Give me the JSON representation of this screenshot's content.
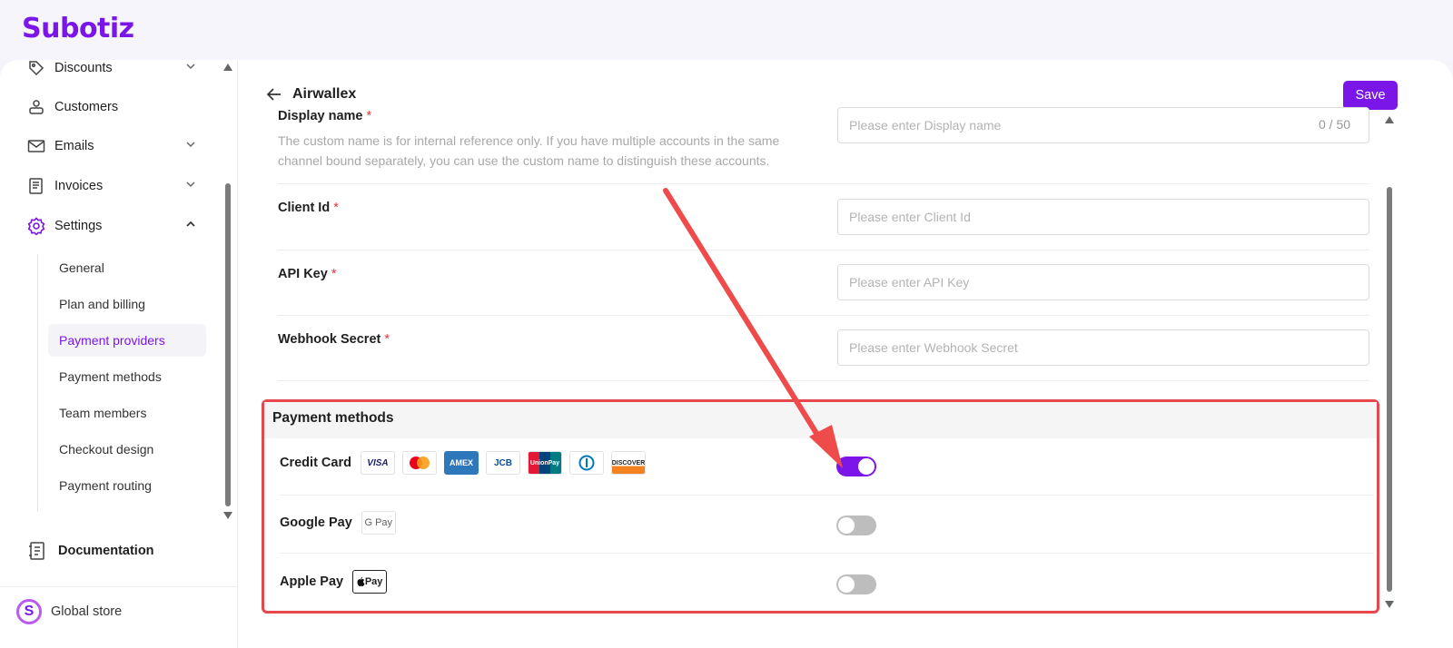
{
  "brand": {
    "name": "Subotiz"
  },
  "sidebar": {
    "items": [
      {
        "label": "Discounts"
      },
      {
        "label": "Customers"
      },
      {
        "label": "Emails"
      },
      {
        "label": "Invoices"
      },
      {
        "label": "Settings"
      }
    ],
    "settings_sub": [
      {
        "label": "General"
      },
      {
        "label": "Plan and billing"
      },
      {
        "label": "Payment providers"
      },
      {
        "label": "Payment methods"
      },
      {
        "label": "Team members"
      },
      {
        "label": "Checkout design"
      },
      {
        "label": "Payment routing"
      }
    ],
    "documentation": "Documentation",
    "store": {
      "name": "Global store",
      "logo_letter": "S"
    }
  },
  "main": {
    "title": "Airwallex",
    "save_label": "Save",
    "fields": {
      "display_name": {
        "label": "Display name",
        "help": "The custom name is for internal reference only. If you have multiple accounts in the same channel bound separately, you can use the custom name to distinguish these accounts.",
        "placeholder": "Please enter Display name",
        "value": "",
        "counter": "0 / 50"
      },
      "client_id": {
        "label": "Client Id",
        "placeholder": "Please enter Client Id",
        "value": ""
      },
      "api_key": {
        "label": "API Key",
        "placeholder": "Please enter API Key",
        "value": ""
      },
      "webhook_secret": {
        "label": "Webhook Secret",
        "placeholder": "Please enter Webhook Secret",
        "value": ""
      }
    },
    "required_mark": "*",
    "payment_methods": {
      "title": "Payment methods",
      "methods": [
        {
          "label": "Credit Card",
          "enabled": true,
          "logos": [
            "VISA",
            "Mastercard",
            "AMEX",
            "JCB",
            "UnionPay",
            "Diners",
            "DISCOVER"
          ]
        },
        {
          "label": "Google Pay",
          "enabled": false,
          "logos": [
            "G Pay"
          ]
        },
        {
          "label": "Apple Pay",
          "enabled": false,
          "logos": [
            "Pay"
          ]
        }
      ]
    }
  },
  "colors": {
    "brand": "#7b16e8",
    "annotation": "#e5484d",
    "required": "#e0383e"
  }
}
